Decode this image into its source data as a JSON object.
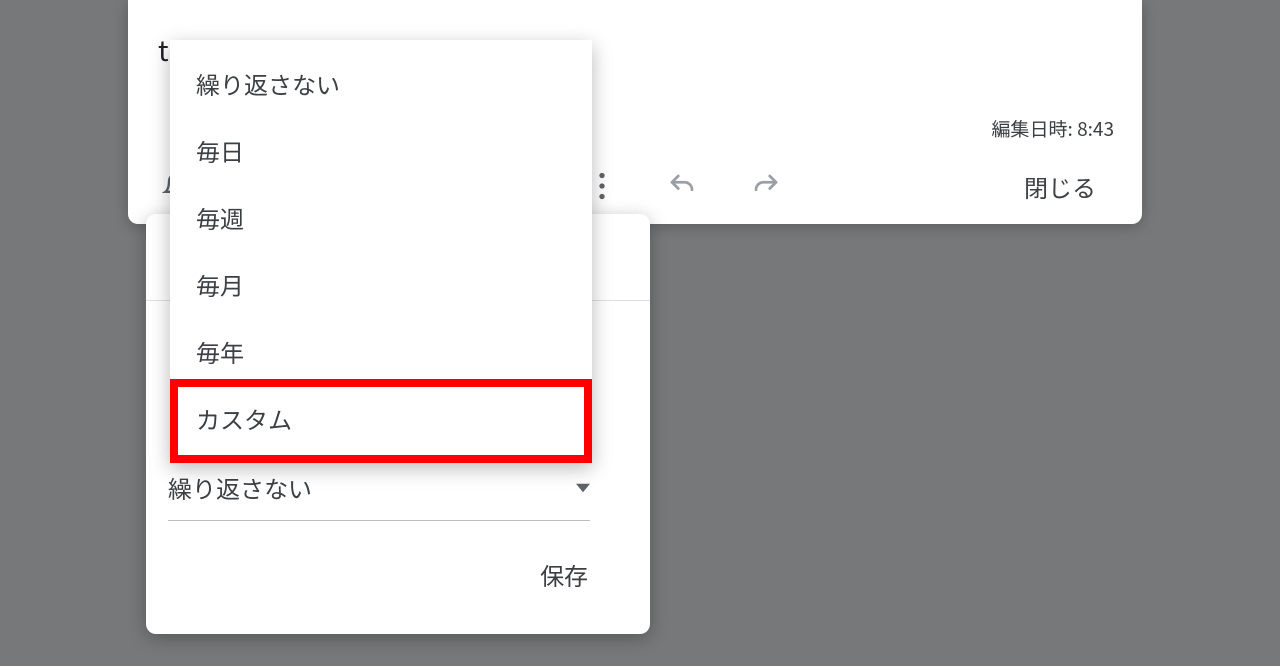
{
  "note": {
    "title_hint": "t",
    "edit_time_label": "編集日時: 8:43",
    "close_label": "閉じる"
  },
  "reminder": {
    "repeat_selected": "繰り返さない",
    "save_label": "保存"
  },
  "dropdown": {
    "options": [
      "繰り返さない",
      "毎日",
      "毎週",
      "毎月",
      "毎年",
      "カスタム"
    ]
  },
  "highlight": {
    "color": "#ff0000"
  }
}
